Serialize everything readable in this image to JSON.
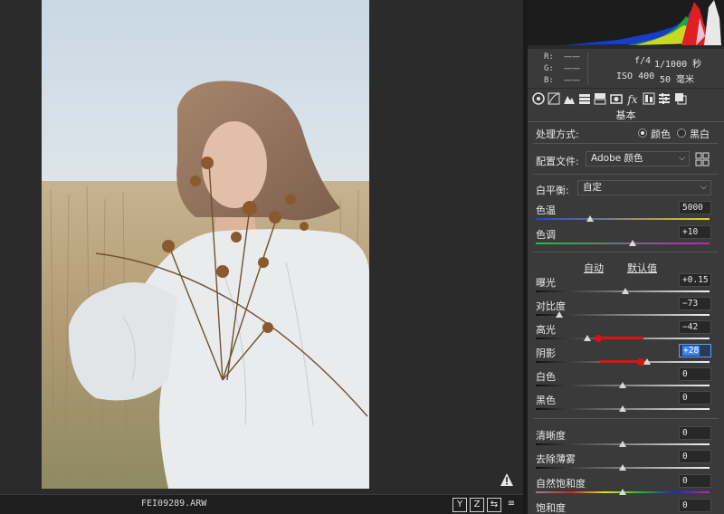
{
  "preview": {
    "filename": "FEI09289.ARW",
    "bottom_buttons": [
      "Y",
      "Z",
      "⇆",
      "≡"
    ]
  },
  "meta": {
    "r_label": "R:",
    "g_label": "G:",
    "b_label": "B:",
    "r_value": "——",
    "g_value": "——",
    "b_value": "——",
    "aperture": "f/4",
    "shutter": "1/1000 秒",
    "iso": "ISO 400",
    "focal": "50 毫米"
  },
  "tools": [
    "basic-icon",
    "tone-curve-icon",
    "detail-icon",
    "hsl-icon",
    "split-tone-icon",
    "lens-icon",
    "fx-icon",
    "calibration-icon",
    "presets-icon",
    "snapshots-icon"
  ],
  "section_title": "基本",
  "treatment": {
    "label": "处理方式:",
    "color_label": "颜色",
    "bw_label": "黑白",
    "selected": "颜色"
  },
  "profile": {
    "label": "配置文件:",
    "value": "Adobe 颜色"
  },
  "white_balance": {
    "label": "白平衡:",
    "value": "自定"
  },
  "sliders_wb": [
    {
      "label": "色温",
      "value": "5000",
      "pos": 0.31
    },
    {
      "label": "色调",
      "value": "+10",
      "pos": 0.56
    }
  ],
  "auto_label": "自动",
  "default_label": "默认值",
  "sliders_tone": [
    {
      "label": "曝光",
      "value": "+0.15",
      "pos": 0.51
    },
    {
      "label": "对比度",
      "value": "−73",
      "pos": 0.14
    },
    {
      "label": "高光",
      "value": "−42",
      "pos": 0.29
    },
    {
      "label": "阴影",
      "value": "+28",
      "pos": 0.64
    },
    {
      "label": "白色",
      "value": "0",
      "pos": 0.5
    },
    {
      "label": "黑色",
      "value": "0",
      "pos": 0.5
    }
  ],
  "sliders_presence": [
    {
      "label": "清晰度",
      "value": "0",
      "pos": 0.5
    },
    {
      "label": "去除薄雾",
      "value": "0",
      "pos": 0.5
    },
    {
      "label": "自然饱和度",
      "value": "0",
      "pos": 0.5
    },
    {
      "label": "饱和度",
      "value": "0",
      "pos": 0.5
    }
  ],
  "colors": {
    "accent": "#3d7ff0",
    "annotation": "#e01010"
  }
}
